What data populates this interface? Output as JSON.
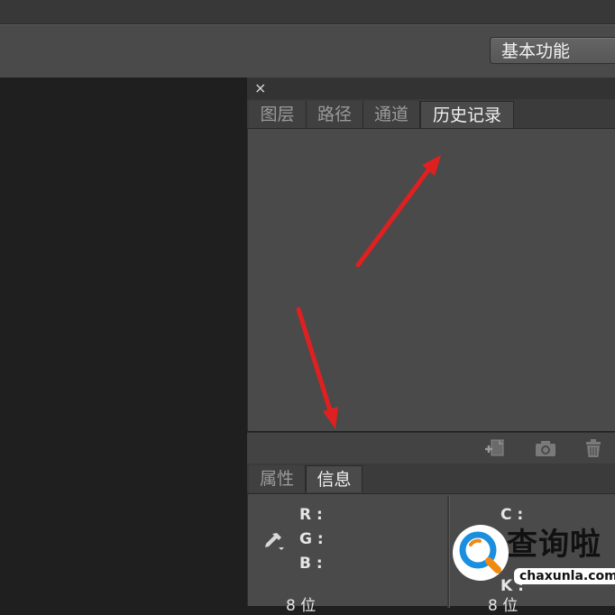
{
  "toolbar": {
    "workspace_label": "基本功能"
  },
  "panel": {
    "close_glyph": "×"
  },
  "history_panel": {
    "tabs": [
      {
        "label": "图层",
        "active": false
      },
      {
        "label": "路径",
        "active": false
      },
      {
        "label": "通道",
        "active": false
      },
      {
        "label": "历史记录",
        "active": true
      }
    ],
    "footer_icons": [
      "new-document-from-state-icon",
      "camera-snapshot-icon",
      "trash-icon"
    ]
  },
  "info_panel": {
    "tabs": [
      {
        "label": "属性",
        "active": false
      },
      {
        "label": "信息",
        "active": true
      }
    ],
    "rgb_labels": [
      "R :",
      "G :",
      "B :"
    ],
    "cmyk_labels": [
      "C :",
      "K :"
    ],
    "bit_label_left": "8 位",
    "bit_label_right": "8 位",
    "picker_icon": "eyedropper-icon"
  },
  "watermark": {
    "text": "查询啦",
    "sub": "chaxunla.com"
  },
  "annotation": {
    "arrow_color": "#e02020"
  },
  "colors": {
    "panel_bg": "#4a4a4a",
    "canvas_bg": "#1f1f1f"
  }
}
